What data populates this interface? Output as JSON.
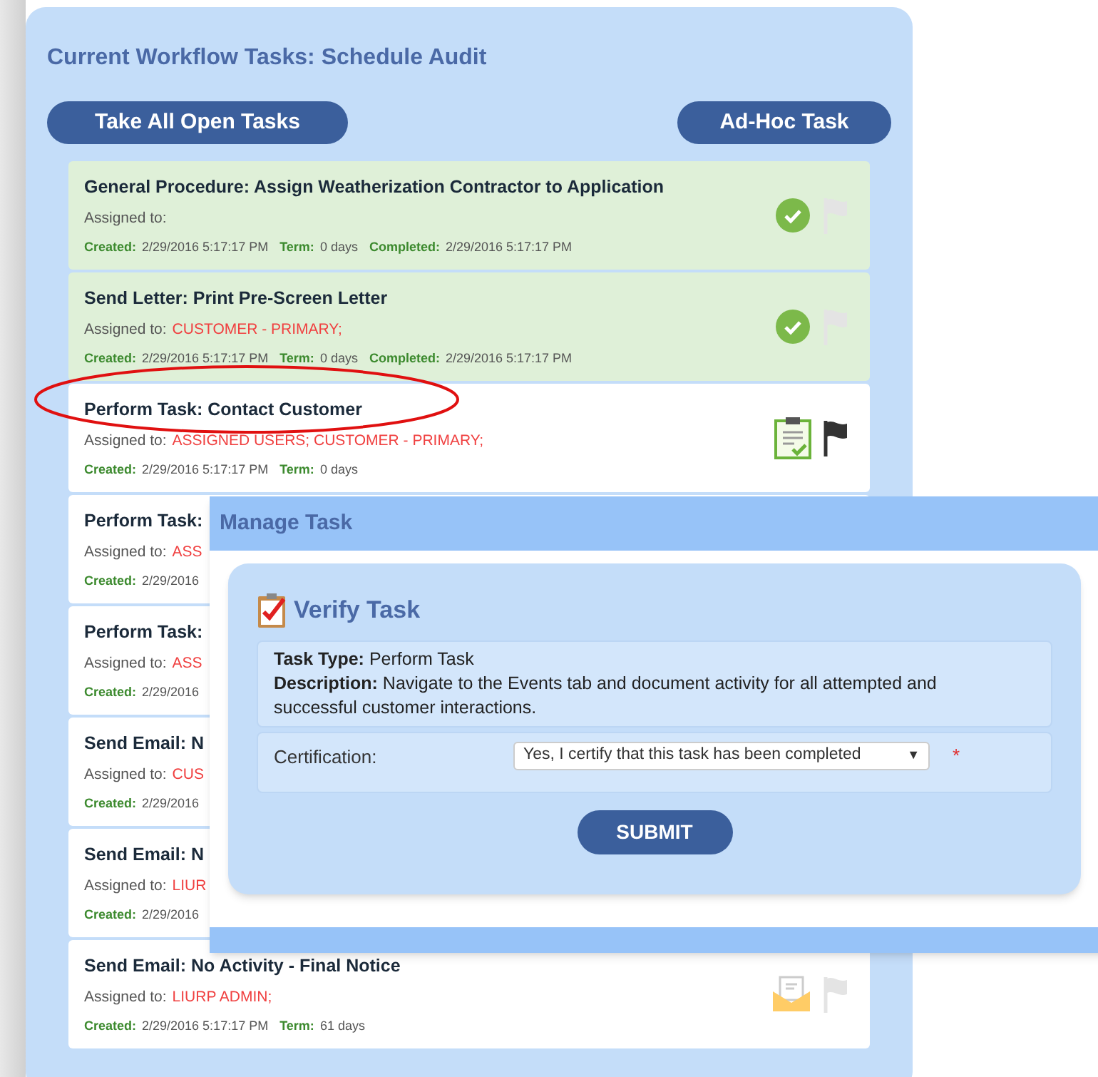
{
  "panel": {
    "title": "Current Workflow Tasks: Schedule Audit"
  },
  "buttons": [
    "Take All Open Tasks",
    "Ad-Hoc Task"
  ],
  "tasks": [
    {
      "title": "General Procedure: Assign Weatherization Contractor to Application",
      "assigned_label": "Assigned to:",
      "created_label": "Created:",
      "created": "2/29/2016 5:17:17 PM",
      "term_label": "Term:",
      "term": "0 days",
      "completed_label": "Completed:",
      "completed": "2/29/2016 5:17:17 PM",
      "kind": "completed",
      "flagged": false,
      "highlighted": false
    },
    {
      "title": "Send Letter: Print Pre-Screen Letter",
      "assigned_label": "Assigned to:",
      "assignees": "CUSTOMER - PRIMARY;",
      "created_label": "Created:",
      "created": "2/29/2016 5:17:17 PM",
      "term_label": "Term:",
      "term": "0 days",
      "completed_label": "Completed:",
      "completed": "2/29/2016 5:17:17 PM",
      "kind": "completed",
      "flagged": false,
      "highlighted": false
    },
    {
      "title": "Perform Task: Contact Customer",
      "assigned_label": "Assigned to:",
      "assignees": "ASSIGNED USERS; CUSTOMER - PRIMARY;",
      "created_label": "Created:",
      "created": "2/29/2016 5:17:17 PM",
      "term_label": "Term:",
      "term": "0 days",
      "kind": "task",
      "flagged": true,
      "highlighted": true
    },
    {
      "title": "Perform Task:",
      "assigned_label": "Assigned to:",
      "assignees": "ASS",
      "created_label": "Created:",
      "created": "2/29/2016",
      "kind": "hidden"
    },
    {
      "title": "Perform Task:",
      "assigned_label": "Assigned to:",
      "assignees": "ASS",
      "created_label": "Created:",
      "created": "2/29/2016",
      "kind": "hidden"
    },
    {
      "title": "Send Email: N",
      "assigned_label": "Assigned to:",
      "assignees": "CUS",
      "created_label": "Created:",
      "created": "2/29/2016",
      "kind": "hidden"
    },
    {
      "title": "Send Email: N",
      "assigned_label": "Assigned to:",
      "assignees": "LIUR",
      "created_label": "Created:",
      "created": "2/29/2016",
      "kind": "hidden"
    },
    {
      "title": "Send Email: No Activity - Final Notice",
      "assigned_label": "Assigned to:",
      "assignees": "LIURP ADMIN;",
      "created_label": "Created:",
      "created": "2/29/2016 5:17:17 PM",
      "term_label": "Term:",
      "term": "61 days",
      "kind": "email",
      "flagged": false,
      "highlighted": false
    }
  ],
  "dialog": {
    "title": "Manage Task",
    "heading": "Verify Task",
    "task_type_label": "Task Type:",
    "task_type": "Perform Task",
    "description_label": "Description:",
    "description": "Navigate to the Events tab and document activity for all attempted and successful customer interactions.",
    "certification_label": "Certification:",
    "certification": "Yes, I certify that this task has been completed",
    "dropdown_icon": "▼",
    "required_mark": "*",
    "submit": "SUBMIT"
  }
}
